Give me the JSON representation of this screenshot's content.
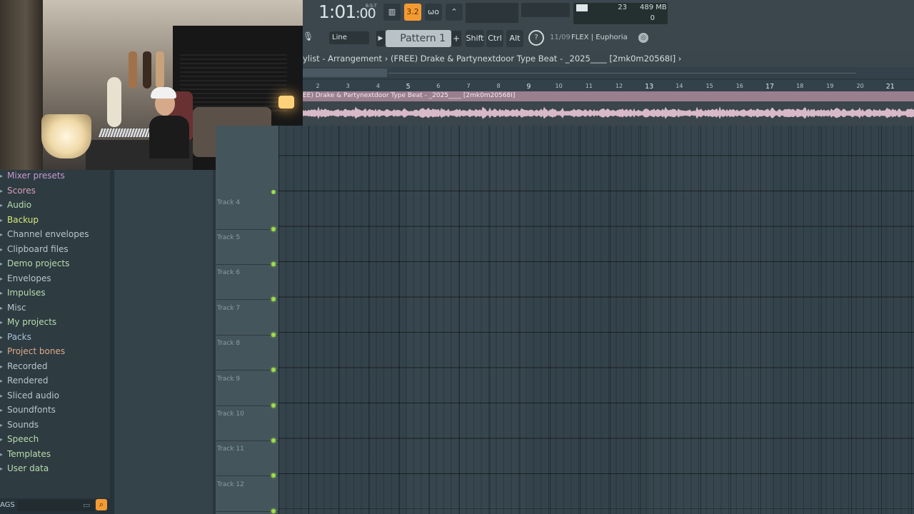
{
  "toolbar": {
    "time_main": "1:01",
    "time_sub": ":00",
    "time_mode": "B:S:T",
    "btn_32": "3.2",
    "btn_wo": "ωο",
    "cpu_value": "23",
    "memory": "489 MB",
    "polyphony": "0"
  },
  "toolbar2": {
    "snap": "Line",
    "pattern": "Pattern 1",
    "shift": "Shift",
    "ctrl": "Ctrl",
    "alt": "Alt",
    "hint_count": "11/09",
    "hint_text": "FLEX | Euphoria"
  },
  "playlist": {
    "title": "ylist - Arrangement › (FREE) Drake & Partynextdoor Type Beat - _2025____ [2mk0m20568I] ›",
    "clip_title": "EE) Drake & Partynextdoor Type Beat - _2025____ [2mk0m20568I]",
    "ruler_ticks": [
      "2",
      "3",
      "4",
      "5",
      "6",
      "7",
      "8",
      "9",
      "10",
      "11",
      "12",
      "13",
      "14",
      "15",
      "16",
      "17",
      "18",
      "19",
      "20",
      "21"
    ],
    "tracks": [
      "Track 4",
      "Track 5",
      "Track 6",
      "Track 7",
      "Track 8",
      "Track 9",
      "Track 10",
      "Track 11",
      "Track 12"
    ]
  },
  "browser": {
    "items": [
      {
        "label": "Mixer presets",
        "color": "#c79bd0"
      },
      {
        "label": "Scores",
        "color": "#d7a0b8"
      },
      {
        "label": "Audio",
        "color": "#b9dcae"
      },
      {
        "label": "Backup",
        "color": "#d7e87a"
      },
      {
        "label": "Channel envelopes",
        "color": "#b9c6cb"
      },
      {
        "label": "Clipboard files",
        "color": "#b9c6cb"
      },
      {
        "label": "Demo projects",
        "color": "#b9dcae"
      },
      {
        "label": "Envelopes",
        "color": "#b9c6cb"
      },
      {
        "label": "Impulses",
        "color": "#b9dcae"
      },
      {
        "label": "Misc",
        "color": "#b9c6cb"
      },
      {
        "label": "My projects",
        "color": "#b9dcae"
      },
      {
        "label": "Packs",
        "color": "#a8c3d8"
      },
      {
        "label": "Project bones",
        "color": "#e0a98a"
      },
      {
        "label": "Recorded",
        "color": "#b9c6cb"
      },
      {
        "label": "Rendered",
        "color": "#b9c6cb"
      },
      {
        "label": "Sliced audio",
        "color": "#b9c6cb"
      },
      {
        "label": "Soundfonts",
        "color": "#b9c6cb"
      },
      {
        "label": "Sounds",
        "color": "#b9c6cb"
      },
      {
        "label": "Speech",
        "color": "#b9dcae"
      },
      {
        "label": "Templates",
        "color": "#b9dcae"
      },
      {
        "label": "User data",
        "color": "#b9dcae"
      }
    ],
    "tags_label": "AGS"
  },
  "colors": {
    "accent": "#f39b32",
    "clip": "#9a7f8e",
    "wave": "#d7b9c9",
    "led": "#9ddc4a"
  }
}
